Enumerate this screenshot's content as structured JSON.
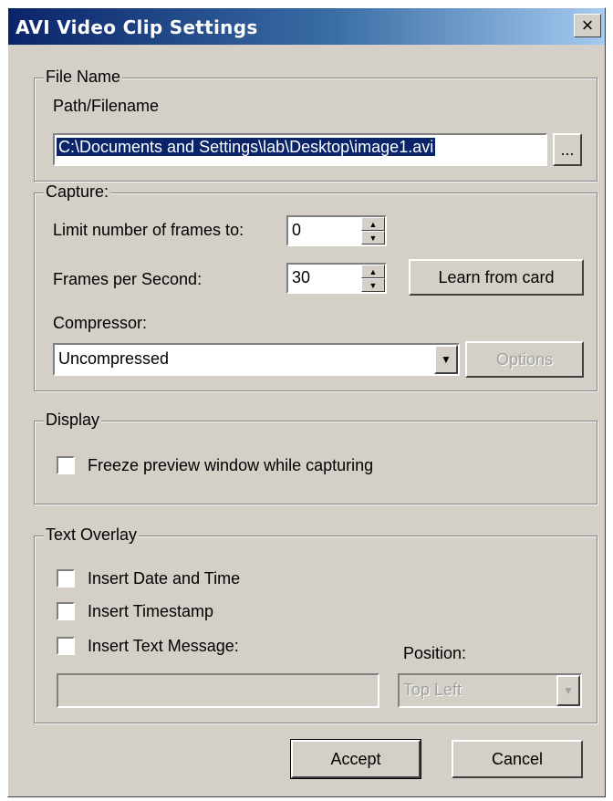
{
  "window": {
    "title": "AVI Video Clip Settings",
    "close_label": "×"
  },
  "file_name": {
    "legend": "File Name",
    "path_label": "Path/Filename",
    "path_value": "C:\\Documents and Settings\\lab\\Desktop\\image1.avi",
    "browse_label": "..."
  },
  "capture": {
    "legend": "Capture:",
    "limit_label": "Limit number of frames to:",
    "limit_value": "0",
    "fps_label": "Frames per Second:",
    "fps_value": "30",
    "learn_button": "Learn from card",
    "compressor_label": "Compressor:",
    "compressor_value": "Uncompressed",
    "options_button": "Options"
  },
  "display": {
    "legend": "Display",
    "freeze_label": "Freeze preview window while capturing",
    "freeze_checked": false
  },
  "text_overlay": {
    "legend": "Text Overlay",
    "date_time_label": "Insert Date and Time",
    "timestamp_label": "Insert Timestamp",
    "text_message_label": "Insert Text Message:",
    "text_message_value": "",
    "position_label": "Position:",
    "position_value": "Top Left"
  },
  "buttons": {
    "accept": "Accept",
    "cancel": "Cancel"
  },
  "colors": {
    "title_bar_start": "#0a246a",
    "title_bar_end": "#a6caf0",
    "dialog_bg": "#d4d0c8",
    "selection": "#0a246a"
  },
  "icons": {
    "spin_up": "up-arrow-icon",
    "spin_down": "down-arrow-icon",
    "dropdown": "chevron-down-icon"
  }
}
